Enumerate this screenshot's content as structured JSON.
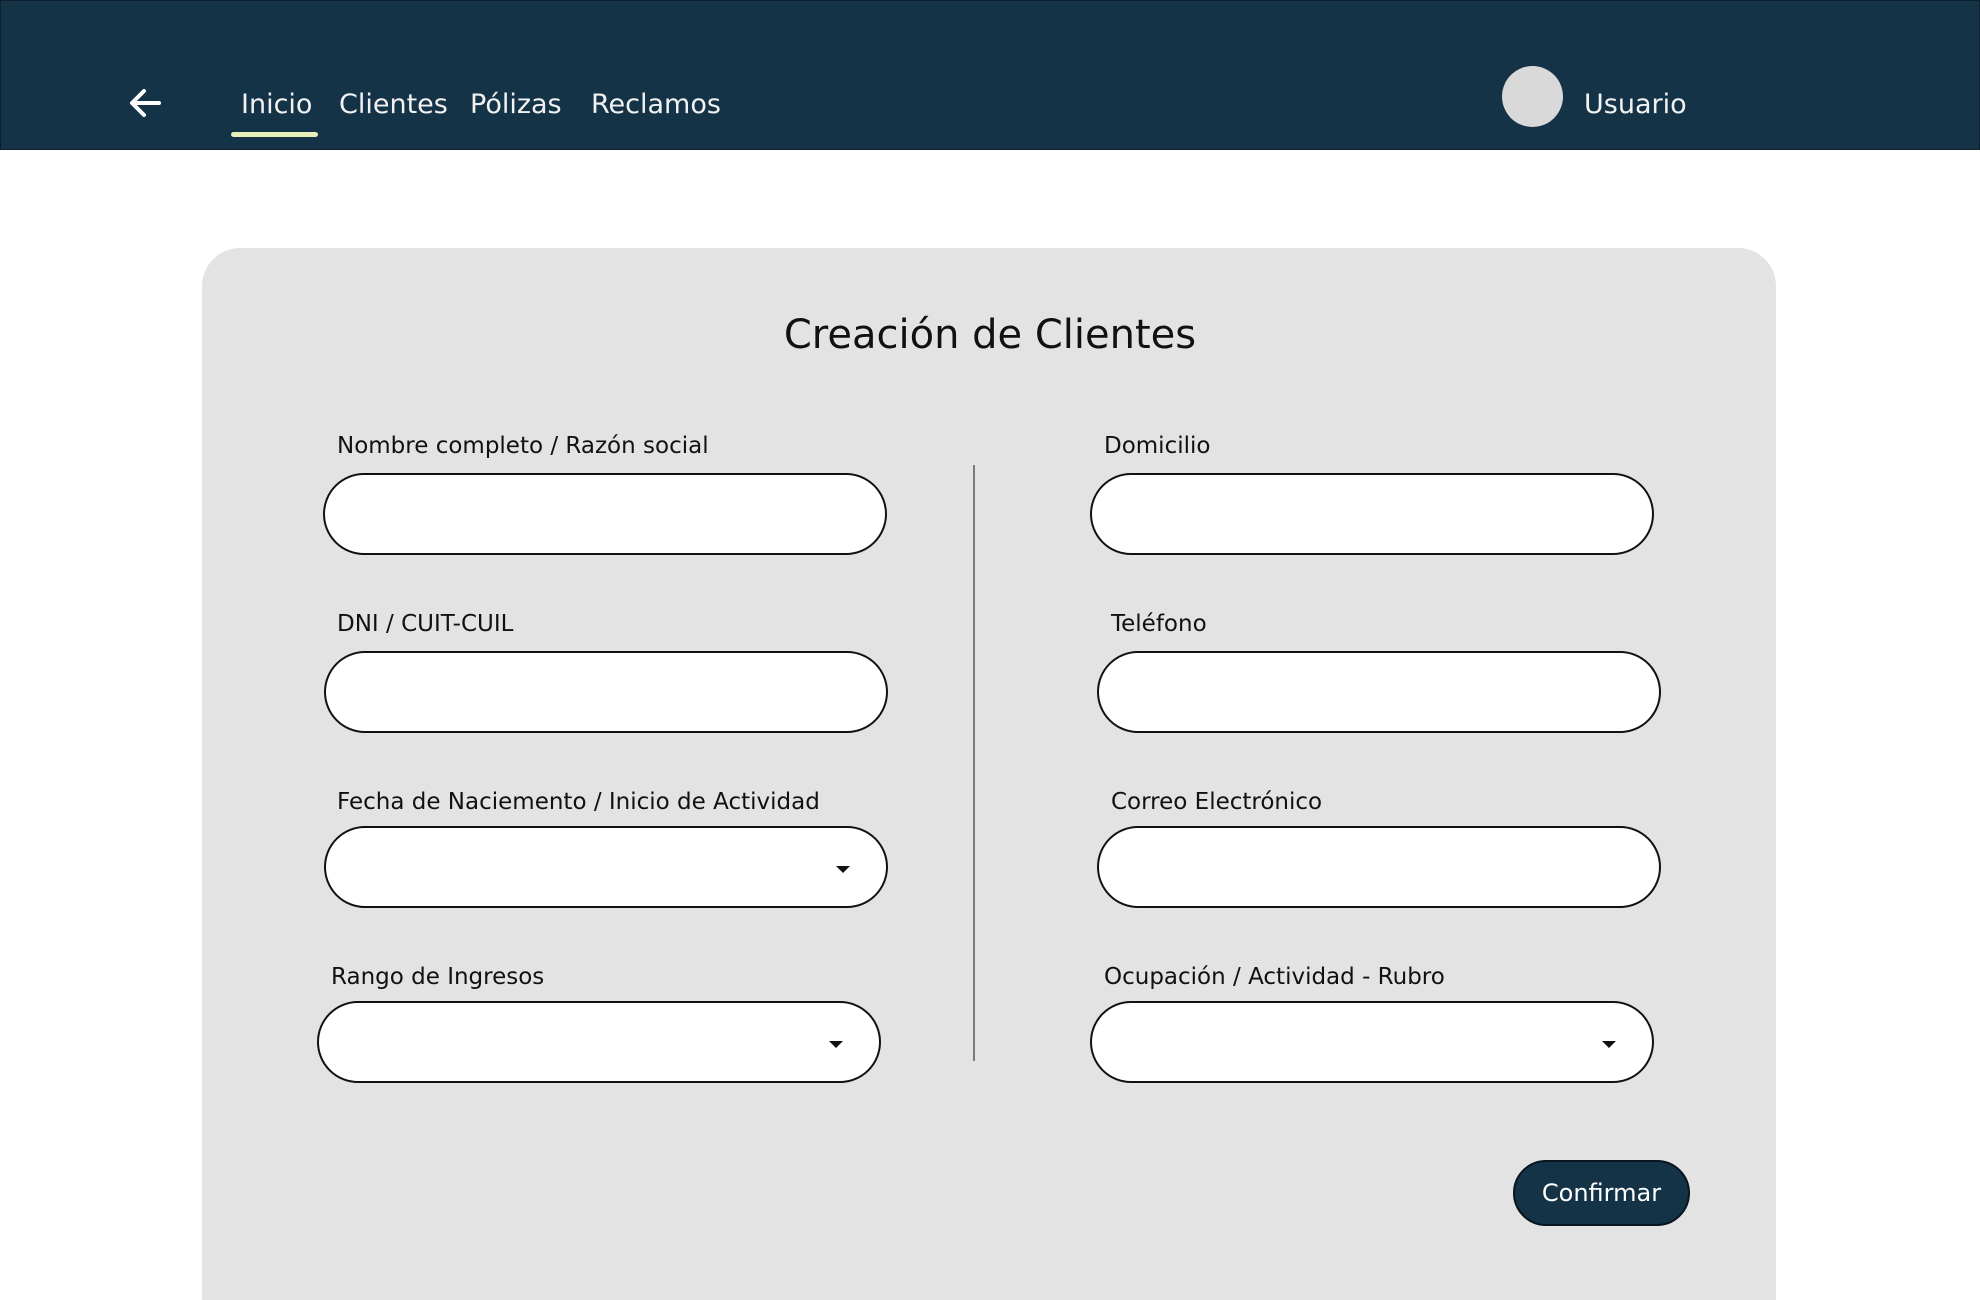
{
  "header": {
    "nav": [
      {
        "label": "Inicio",
        "active": true
      },
      {
        "label": "Clientes"
      },
      {
        "label": "Pólizas"
      },
      {
        "label": "Reclamos"
      }
    ],
    "user_label": "Usuario"
  },
  "form": {
    "title": "Creación de Clientes",
    "left_fields": [
      {
        "label": "Nombre completo / Razón social",
        "value": "",
        "type": "text"
      },
      {
        "label": "DNI / CUIT-CUIL",
        "value": "",
        "type": "text"
      },
      {
        "label": "Fecha de Naciemento / Inicio de Actividad",
        "value": "",
        "type": "select"
      },
      {
        "label": "Rango de Ingresos",
        "value": "",
        "type": "select"
      }
    ],
    "right_fields": [
      {
        "label": "Domicilio",
        "value": "",
        "type": "text"
      },
      {
        "label": "Teléfono",
        "value": "",
        "type": "text"
      },
      {
        "label": "Correo Electrónico",
        "value": "",
        "type": "text"
      },
      {
        "label": "Ocupación / Actividad - Rubro",
        "value": "",
        "type": "select"
      }
    ],
    "confirm_label": "Confirmar"
  },
  "colors": {
    "header_bg": "#143347",
    "card_bg": "#e3e3e3",
    "active_underline": "#e6f0b8",
    "button_bg": "#143347"
  },
  "icons": {
    "back": "arrow-left-icon",
    "dropdown": "caret-down-icon"
  }
}
